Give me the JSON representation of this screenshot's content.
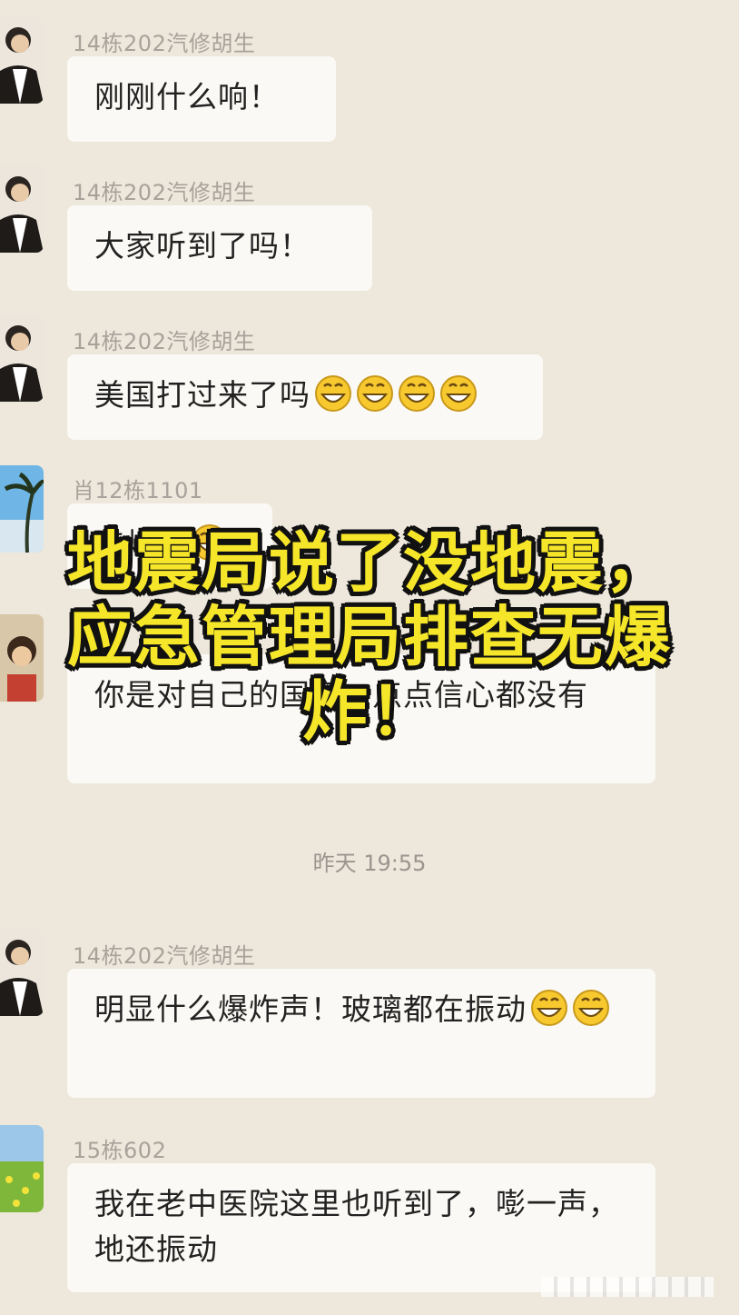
{
  "messages": [
    {
      "sender": "14栋202汽修胡生",
      "text": "刚刚什么响！",
      "emojis": 0
    },
    {
      "sender": "14栋202汽修胡生",
      "text": "大家听到了吗！",
      "emojis": 0
    },
    {
      "sender": "14栋202汽修胡生",
      "text": "美国打过来了吗",
      "emojis": 4
    },
    {
      "sender": "肖12栋1101",
      "text": "东炸机",
      "emojis": 1
    },
    {
      "sender": "",
      "text": "你是对自己的国家一点点信心都没有",
      "emojis": 0
    },
    {
      "sender": "14栋202汽修胡生",
      "text": "明显什么爆炸声！玻璃都在振动",
      "emojis": 2
    },
    {
      "sender": "15栋602",
      "text": "我在老中医院这里也听到了，嘭一声，地还振动",
      "emojis": 0
    }
  ],
  "timestamp": "昨天 19:55",
  "overlay": {
    "line1": "地震局说了没地震，",
    "line2": "应急管理局排查无爆",
    "line3": "炸！"
  },
  "colors": {
    "background": "#ede7dc",
    "bubble": "#fbf9f5",
    "overlay_text": "#f6e62a",
    "overlay_outline": "#111111"
  },
  "icons": [
    "grin-emoji-icon",
    "person-avatar-icon",
    "beach-avatar-icon",
    "field-avatar-icon"
  ]
}
